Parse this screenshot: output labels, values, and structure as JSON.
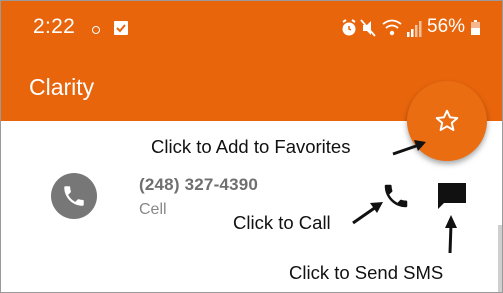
{
  "status_bar": {
    "time": "2:22",
    "battery_text": "56%"
  },
  "app_bar": {
    "title": "Clarity"
  },
  "contact": {
    "phone_number": "(248) 327-4390",
    "phone_type": "Cell"
  },
  "annotations": {
    "favorites": "Click to Add to Favorites",
    "call": "Click to Call",
    "sms": "Click to Send SMS"
  },
  "colors": {
    "accent": "#e8650c",
    "text_dark": "#111111",
    "muted": "#888888"
  },
  "icons": {
    "favorite": "star-outline-icon",
    "call": "phone-icon",
    "sms": "message-icon",
    "avatar": "phone-icon",
    "battery": "battery-icon",
    "wifi": "wifi-icon",
    "signal": "signal-icon"
  }
}
